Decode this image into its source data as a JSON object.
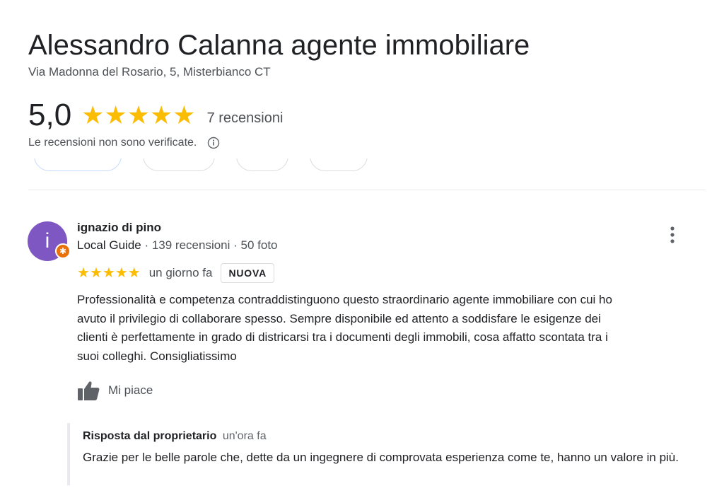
{
  "business": {
    "name": "Alessandro Calanna agente immobiliare",
    "address": "Via Madonna del Rosario, 5, Misterbianco CT"
  },
  "rating": {
    "value": "5,0",
    "stars": 5,
    "count_text": "7 recensioni",
    "disclaimer": "Le recensioni non sono verificate."
  },
  "icons": {
    "info": "info-icon",
    "star": "star-icon",
    "more": "more-vert-icon",
    "like": "thumbs-up-icon",
    "guide_badge": "local-guide-badge-icon"
  },
  "colors": {
    "star": "#fbbc04",
    "avatar": "#7e57c2",
    "guide_badge": "#e8710a"
  },
  "review": {
    "avatar_letter": "i",
    "author": "ignazio di pino",
    "author_badge": "Local Guide",
    "author_stats": " · 139 recensioni · 50 foto",
    "stars": 5,
    "time": "un giorno fa",
    "badge": "NUOVA",
    "text": "Professionalità e competenza contraddistinguono questo straordinario agente immobiliare con cui ho\navuto il privilegio di collaborare spesso. Sempre disponibile ed attento a soddisfare le esigenze dei\nclienti  è perfettamente in grado di districarsi tra i documenti degli immobili, cosa affatto scontata tra i\nsuoi colleghi. Consigliatissimo",
    "like_label": "Mi piace"
  },
  "reply": {
    "owner_label": "Risposta dal proprietario",
    "time": "un'ora fa",
    "text": "Grazie per le belle parole che, dette da un ingegnere di comprovata esperienza come te, hanno un valore in più."
  }
}
